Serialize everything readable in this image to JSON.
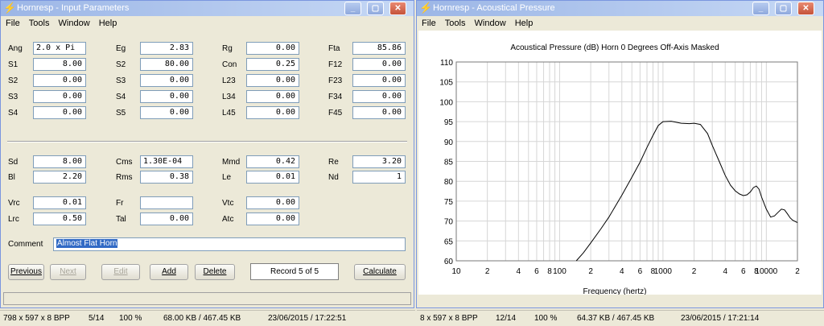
{
  "left_window": {
    "title": "Hornresp - Input Parameters",
    "menu": [
      "File",
      "Tools",
      "Window",
      "Help"
    ],
    "rows1": [
      [
        {
          "label": "Ang",
          "value": "2.0 x Pi",
          "align": "left"
        },
        {
          "label": "Eg",
          "value": "2.83"
        },
        {
          "label": "Rg",
          "value": "0.00"
        },
        {
          "label": "Fta",
          "value": "85.86"
        }
      ],
      [
        {
          "label": "S1",
          "value": "8.00"
        },
        {
          "label": "S2",
          "value": "80.00"
        },
        {
          "label": "Con",
          "value": "0.25"
        },
        {
          "label": "F12",
          "value": "0.00"
        }
      ],
      [
        {
          "label": "S2",
          "value": "0.00"
        },
        {
          "label": "S3",
          "value": "0.00"
        },
        {
          "label": "L23",
          "value": "0.00"
        },
        {
          "label": "F23",
          "value": "0.00"
        }
      ],
      [
        {
          "label": "S3",
          "value": "0.00"
        },
        {
          "label": "S4",
          "value": "0.00"
        },
        {
          "label": "L34",
          "value": "0.00"
        },
        {
          "label": "F34",
          "value": "0.00"
        }
      ],
      [
        {
          "label": "S4",
          "value": "0.00"
        },
        {
          "label": "S5",
          "value": "0.00"
        },
        {
          "label": "L45",
          "value": "0.00"
        },
        {
          "label": "F45",
          "value": "0.00"
        }
      ]
    ],
    "rows2": [
      [
        {
          "label": "Sd",
          "value": "8.00"
        },
        {
          "label": "Cms",
          "value": "1.30E-04",
          "align": "left"
        },
        {
          "label": "Mmd",
          "value": "0.42"
        },
        {
          "label": "Re",
          "value": "3.20"
        }
      ],
      [
        {
          "label": "Bl",
          "value": "2.20"
        },
        {
          "label": "Rms",
          "value": "0.38"
        },
        {
          "label": "Le",
          "value": "0.01"
        },
        {
          "label": "Nd",
          "value": "1"
        }
      ]
    ],
    "rows3": [
      [
        {
          "label": "Vrc",
          "value": "0.01"
        },
        {
          "label": "Fr",
          "value": ""
        },
        {
          "label": "Vtc",
          "value": "0.00"
        }
      ],
      [
        {
          "label": "Lrc",
          "value": "0.50"
        },
        {
          "label": "Tal",
          "value": "0.00"
        },
        {
          "label": "Atc",
          "value": "0.00"
        }
      ]
    ],
    "comment_label": "Comment",
    "comment_value": "Almost Flat Horn",
    "buttons": {
      "previous": "Previous",
      "next": "Next",
      "edit": "Edit",
      "add": "Add",
      "delete": "Delete",
      "record": "Record 5 of 5",
      "calculate": "Calculate"
    }
  },
  "right_window": {
    "title": "Hornresp - Acoustical Pressure",
    "menu": [
      "File",
      "Tools",
      "Window",
      "Help"
    ]
  },
  "chart_data": {
    "type": "line",
    "title": "Acoustical Pressure (dB)   Horn   0 Degrees Off-Axis   Masked",
    "xlabel": "Frequency (hertz)",
    "ylabel": "",
    "x_scale": "log",
    "xlim": [
      10,
      20000
    ],
    "ylim": [
      60,
      110
    ],
    "y_ticks": [
      60,
      65,
      70,
      75,
      80,
      85,
      90,
      95,
      100,
      105,
      110
    ],
    "x_tick_labels": [
      {
        "x": 10,
        "label": "10"
      },
      {
        "x": 20,
        "label": "2"
      },
      {
        "x": 40,
        "label": "4"
      },
      {
        "x": 60,
        "label": "6"
      },
      {
        "x": 80,
        "label": "8"
      },
      {
        "x": 100,
        "label": "100"
      },
      {
        "x": 200,
        "label": "2"
      },
      {
        "x": 400,
        "label": "4"
      },
      {
        "x": 600,
        "label": "6"
      },
      {
        "x": 800,
        "label": "8"
      },
      {
        "x": 1000,
        "label": "1000"
      },
      {
        "x": 2000,
        "label": "2"
      },
      {
        "x": 4000,
        "label": "4"
      },
      {
        "x": 6000,
        "label": "6"
      },
      {
        "x": 8000,
        "label": "8"
      },
      {
        "x": 10000,
        "label": "10000"
      },
      {
        "x": 20000,
        "label": "2"
      }
    ],
    "grid": true,
    "series": [
      {
        "x": [
          145,
          170,
          200,
          250,
          300,
          400,
          500,
          600,
          700,
          800,
          900,
          1000,
          1200,
          1500,
          1800,
          2000,
          2300,
          2700,
          3000,
          3500,
          4000,
          4500,
          5000,
          5500,
          6000,
          6500,
          7000,
          7500,
          8000,
          8500,
          9000,
          10000,
          11000,
          12000,
          13000,
          14000,
          15000,
          16000,
          17000,
          18000,
          20000
        ],
        "y": [
          60,
          62,
          64.5,
          68,
          71,
          76.5,
          81,
          84.8,
          88.5,
          91.5,
          94,
          95,
          95.1,
          94.6,
          94.5,
          94.6,
          94.3,
          92,
          89,
          85,
          81.5,
          79,
          77.6,
          76.8,
          76.4,
          76.6,
          77.3,
          78.4,
          78.8,
          78,
          76,
          73,
          71,
          71.3,
          72.2,
          73,
          72.8,
          71.8,
          70.8,
          70.2,
          69.6
        ]
      }
    ]
  },
  "status_left": {
    "dims": "798 x 597 x 8 BPP",
    "index": "5/14",
    "zoom": "100 %",
    "size": "68.00 KB / 467.45 KB",
    "datetime": "23/06/2015 / 17:22:51"
  },
  "status_right": {
    "dims": "8 x 597 x 8 BPP",
    "index": "12/14",
    "zoom": "100 %",
    "size": "64.37 KB / 467.45 KB",
    "datetime": "23/06/2015 / 17:21:14"
  }
}
